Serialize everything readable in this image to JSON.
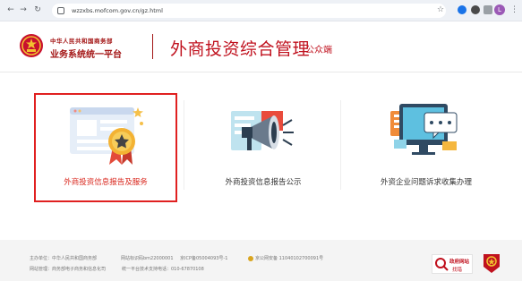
{
  "browser": {
    "url": "wzzxbs.mofcom.gov.cn/gz.html",
    "profile_initial": "L"
  },
  "header": {
    "org_top": "中华人民共和国商务部",
    "org_bottom": "业务系统统一平台",
    "title": "外商投资综合管理",
    "subtitle": "公众端"
  },
  "cards": [
    {
      "label": "外商投资信息报告及服务",
      "selected": true
    },
    {
      "label": "外商投资信息报告公示",
      "selected": false
    },
    {
      "label": "外资企业问题诉求收集办理",
      "selected": false
    }
  ],
  "footer": {
    "sponsor": "主办单位：中华人民共和国商务部",
    "site_id": "网站标识码bm22000001",
    "icp": "京ICP备05004093号-1",
    "police": "京公网安备 11040102700091号",
    "maintainer": "网站管理：商务部电子商务和信息化司",
    "support": "统一平台技术支持电话：010-67870108",
    "gov_badge_top": "政府网站",
    "gov_badge_bottom": "找错"
  },
  "colors": {
    "brand_red": "#c0111e",
    "selected_border": "#e02020",
    "footer_bg": "#f4f4f4"
  }
}
